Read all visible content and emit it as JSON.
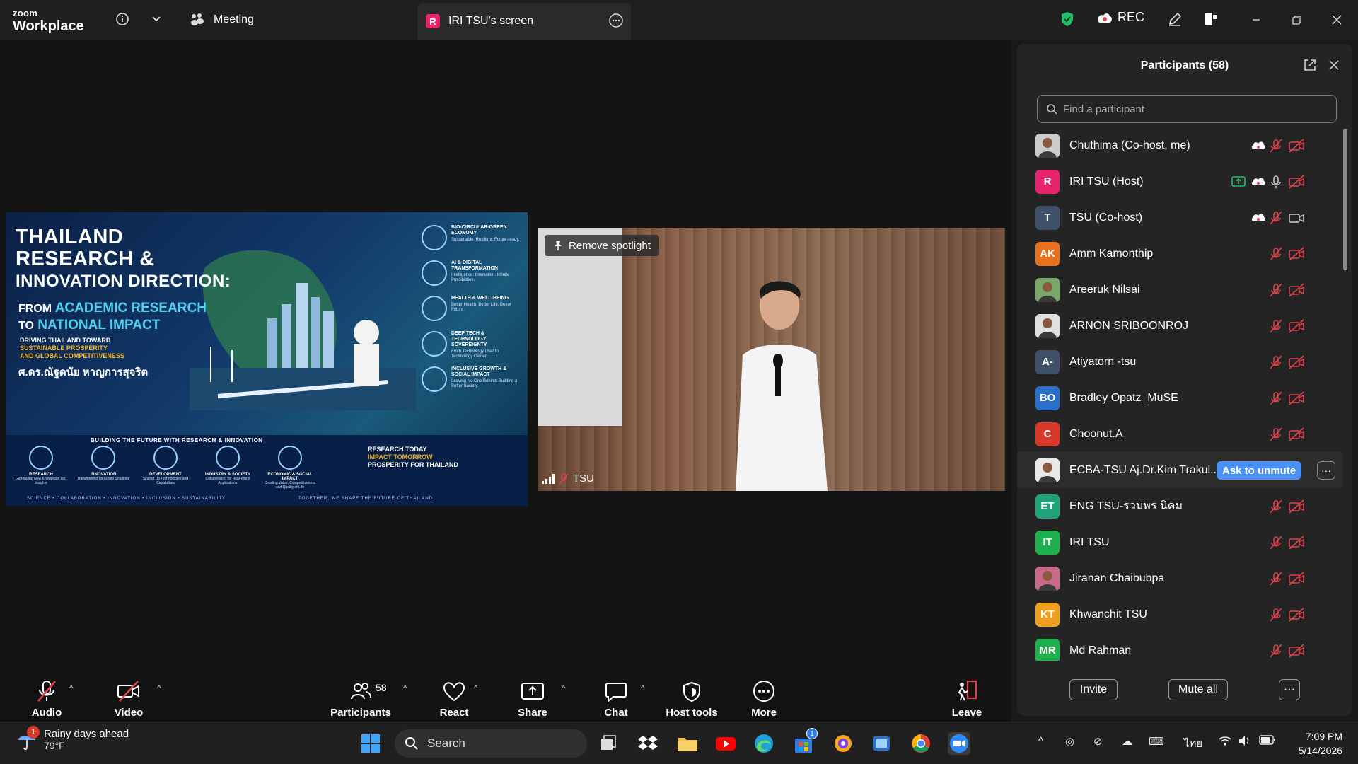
{
  "titlebar": {
    "logo_line1": "zoom",
    "logo_line2": "Workplace",
    "meeting_tab": "Meeting",
    "screen_tab": "IRI TSU's screen",
    "screen_tab_badge": "R",
    "rec_label": "REC"
  },
  "stage": {
    "slide": {
      "title_lines": [
        "THAILAND",
        "RESEARCH &",
        "INNOVATION DIRECTION:"
      ],
      "sub_from": "FROM",
      "sub_academic": "ACADEMIC RESEARCH",
      "sub_to": "TO",
      "sub_national": "NATIONAL IMPACT",
      "driving": "DRIVING THAILAND TOWARD",
      "sustainable": "SUSTAINABLE PROSPERITY",
      "global": "AND GLOBAL COMPETITIVENESS",
      "author": "ศ.ดร.ณัฐดนัย หาญการสุจริต",
      "side_items": [
        {
          "title": "BIO-CIRCULAR-GREEN ECONOMY",
          "desc": "Sustainable. Resilient. Future-ready."
        },
        {
          "title": "AI & DIGITAL TRANSFORMATION",
          "desc": "Intelligence. Innovation. Infinite Possibilities."
        },
        {
          "title": "HEALTH & WELL-BEING",
          "desc": "Better Health. Better Life. Better Future."
        },
        {
          "title": "DEEP TECH & TECHNOLOGY SOVEREIGNTY",
          "desc": "From Technology User to Technology Owner."
        },
        {
          "title": "INCLUSIVE GROWTH & SOCIAL IMPACT",
          "desc": "Leaving No One Behind. Building a Better Society."
        }
      ],
      "band_title": "BUILDING THE FUTURE WITH RESEARCH & INNOVATION",
      "steps": [
        {
          "title": "RESEARCH",
          "desc": "Generating New Knowledge and Insights"
        },
        {
          "title": "INNOVATION",
          "desc": "Transforming Ideas into Solutions"
        },
        {
          "title": "DEVELOPMENT",
          "desc": "Scaling Up Technologies and Capabilities"
        },
        {
          "title": "INDUSTRY & SOCIETY",
          "desc": "Collaborating for Real-World Applications"
        },
        {
          "title": "ECONOMIC & SOCIAL IMPACT",
          "desc": "Creating Value, Competitiveness and Quality of Life"
        }
      ],
      "today1": "RESEARCH TODAY",
      "today2": "IMPACT TOMORROW",
      "today3": "PROSPERITY FOR THAILAND",
      "footer_left": "SCIENCE • COLLABORATION • INNOVATION • INCLUSION • SUSTAINABILITY",
      "footer_right": "TOGETHER, WE SHAPE THE FUTURE OF THAILAND"
    },
    "video": {
      "spotlight_button": "Remove spotlight",
      "name": "TSU"
    }
  },
  "toolbar": {
    "audio": "Audio",
    "video": "Video",
    "participants": "Participants",
    "participants_count": "58",
    "react": "React",
    "share": "Share",
    "chat": "Chat",
    "host_tools": "Host tools",
    "more": "More",
    "leave": "Leave"
  },
  "panel": {
    "title": "Participants (58)",
    "search_placeholder": "Find a participant",
    "ask_to_unmute": "Ask to unmute",
    "invite": "Invite",
    "mute_all": "Mute all",
    "participants": [
      {
        "name": "Chuthima (Co-host, me)",
        "initials": "",
        "color": "#cccccc",
        "photo": true,
        "cloud": true,
        "mic": "muted",
        "cam": "off"
      },
      {
        "name": "IRI TSU (Host)",
        "initials": "R",
        "color": "#e5246b",
        "photo": false,
        "cloud": true,
        "share": true,
        "mic": "on",
        "cam": "off"
      },
      {
        "name": "TSU (Co-host)",
        "initials": "T",
        "color": "#3f5068",
        "photo": false,
        "cloud": true,
        "mic": "muted",
        "cam": "on"
      },
      {
        "name": "Amm Kamonthip",
        "initials": "AK",
        "color": "#e8711f",
        "photo": false,
        "mic": "muted",
        "cam": "off"
      },
      {
        "name": "Areeruk Nilsai",
        "initials": "",
        "color": "#7aa86a",
        "photo": true,
        "mic": "muted",
        "cam": "off"
      },
      {
        "name": "ARNON SRIBOONROJ",
        "initials": "",
        "color": "#e0e0e0",
        "photo": true,
        "mic": "muted",
        "cam": "off"
      },
      {
        "name": "Atiyatorn -tsu",
        "initials": "A-",
        "color": "#3f5068",
        "photo": false,
        "mic": "muted",
        "cam": "off"
      },
      {
        "name": "Bradley Opatz_MuSE",
        "initials": "BO",
        "color": "#2a6fc9",
        "photo": false,
        "mic": "muted",
        "cam": "off"
      },
      {
        "name": "Choonut.A",
        "initials": "C",
        "color": "#d8392b",
        "photo": false,
        "mic": "muted",
        "cam": "off"
      },
      {
        "name": "ECBA-TSU Aj.Dr.Kim Trakul...",
        "initials": "",
        "color": "#e8e8e8",
        "photo": true,
        "highlight": true,
        "mic": "none",
        "cam": "none"
      },
      {
        "name": "ENG TSU-รวมพร นิคม",
        "initials": "ET",
        "color": "#1fa37a",
        "photo": false,
        "mic": "muted",
        "cam": "off"
      },
      {
        "name": "IRI TSU",
        "initials": "IT",
        "color": "#1fb14d",
        "photo": false,
        "mic": "muted",
        "cam": "off"
      },
      {
        "name": "Jiranan Chaibubpa",
        "initials": "",
        "color": "#c96a8a",
        "photo": true,
        "mic": "muted",
        "cam": "off"
      },
      {
        "name": "Khwanchit TSU",
        "initials": "KT",
        "color": "#f0a020",
        "photo": false,
        "mic": "muted",
        "cam": "off"
      },
      {
        "name": "Md Rahman",
        "initials": "MR",
        "color": "#1fb14d",
        "photo": false,
        "mic": "muted",
        "cam": "off"
      }
    ]
  },
  "taskbar": {
    "weather_badge": "1",
    "weather_title": "Rainy days ahead",
    "weather_temp": "79°F",
    "search_label": "Search",
    "store_badge": "1",
    "lang": "ไทย",
    "time": "7:09 PM",
    "date": "5/14/2026"
  },
  "colors": {
    "accent_blue": "#4a90f5",
    "mute_red": "#e0424b",
    "shield_green": "#1fc16b"
  }
}
